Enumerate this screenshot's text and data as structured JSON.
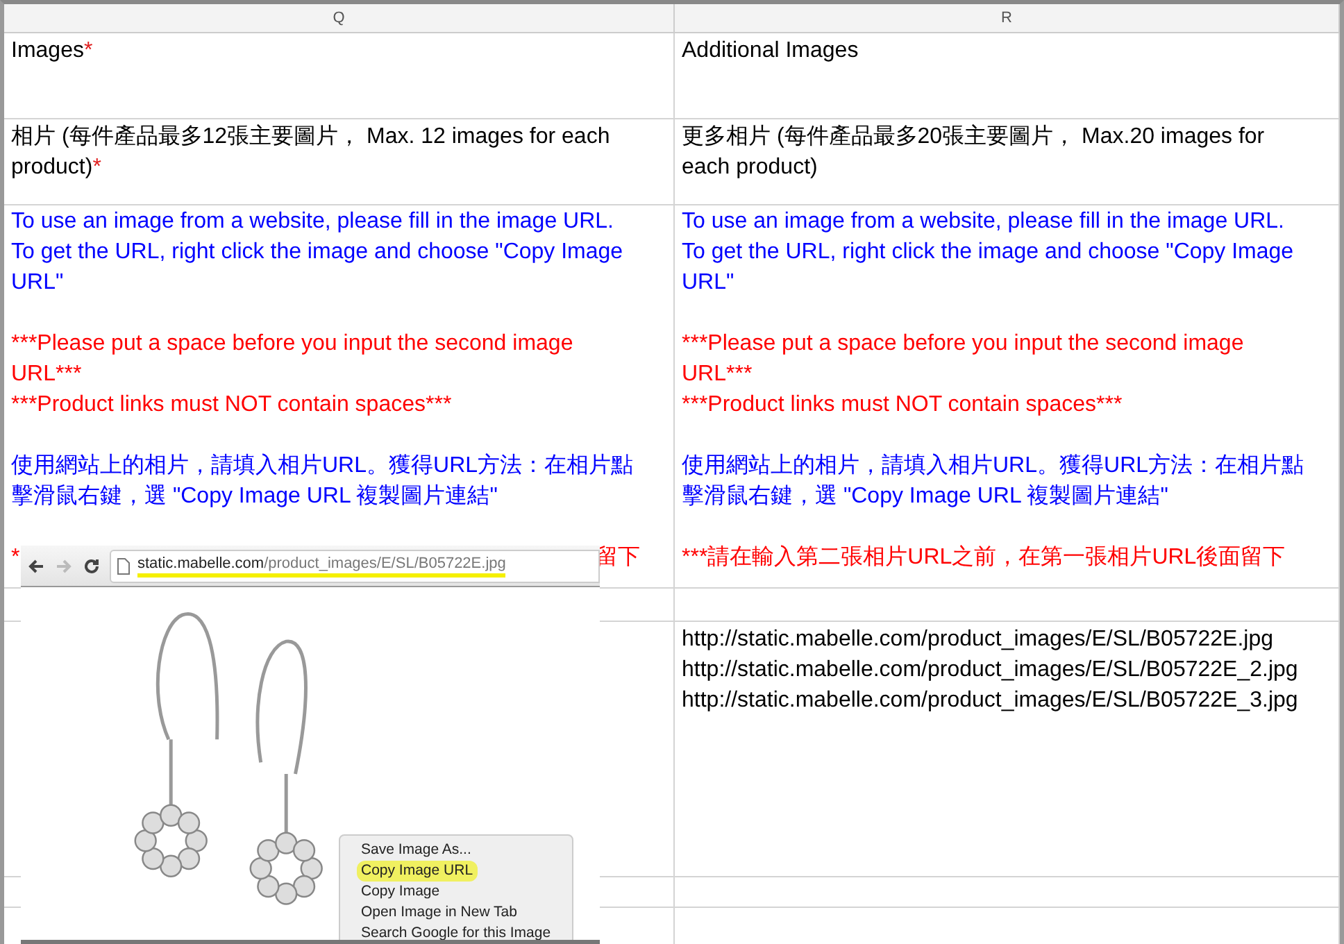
{
  "columns": [
    {
      "letter": "Q"
    },
    {
      "letter": "R"
    }
  ],
  "field_names": [
    {
      "text": "Images",
      "required": true
    },
    {
      "text": "Additional Images",
      "required": false
    }
  ],
  "descriptions": [
    {
      "text": "相片 (每件產品最多12張主要圖片， Max. 12 images for each product)",
      "required": true
    },
    {
      "text": "更多相片 (每件產品最多20張主要圖片， Max.20 images for each product)",
      "required": false
    }
  ],
  "instructions": [
    {
      "paragraphs": [
        {
          "text": "To use an image from a website, please fill in the image URL. To get the URL, right click the image and choose \"Copy Image URL\"",
          "color": "#0000ff"
        },
        {
          "text": "***Please put a space before you input the second image URL***\n***Product links must NOT contain spaces***",
          "color": "#ff0000"
        },
        {
          "text": "使用網站上的相片，請填入相片URL。獲得URL方法：在相片點擊滑鼠右鍵，選 \"Copy Image URL 複製圖片連結\"",
          "color": "#0000ff"
        }
      ],
      "covered_line": {
        "start": "*",
        "end": "留下",
        "color": "#ff0000"
      }
    },
    {
      "paragraphs": [
        {
          "text": "To use an image from a website, please fill in the image URL. To get the URL, right click the image and choose \"Copy Image URL\"",
          "color": "#0000ff"
        },
        {
          "text": "***Please put a space before you input the second image URL***\n***Product links must NOT contain spaces***",
          "color": "#ff0000"
        },
        {
          "text": "使用網站上的相片，請填入相片URL。獲得URL方法：在相片點擊滑鼠右鍵，選 \"Copy Image URL 複製圖片連結\"",
          "color": "#0000ff"
        },
        {
          "text": "***請在輸入第二張相片URL之前，在第一張相片URL後面留下",
          "color": "#ff0000"
        }
      ]
    }
  ],
  "column_r_example_urls": [
    "http://static.mabelle.com/product_images/E/SL/B05722E.jpg",
    "http://static.mabelle.com/product_images/E/SL/B05722E_2.jpg",
    "http://static.mabelle.com/product_images/E/SL/B05722E_3.jpg"
  ],
  "screenshot_overlay": {
    "address_bar": {
      "domain": "static.mabelle.com",
      "path": "/product_images/E/SL/B05722E.jpg"
    },
    "context_menu": [
      {
        "label": "Save Image As...",
        "selected": false
      },
      {
        "label": "Copy Image URL",
        "selected": true
      },
      {
        "label": "Copy Image",
        "selected": false
      },
      {
        "label": "Open Image in New Tab",
        "selected": false
      },
      {
        "label": "Search Google for this Image",
        "selected": false
      }
    ]
  }
}
